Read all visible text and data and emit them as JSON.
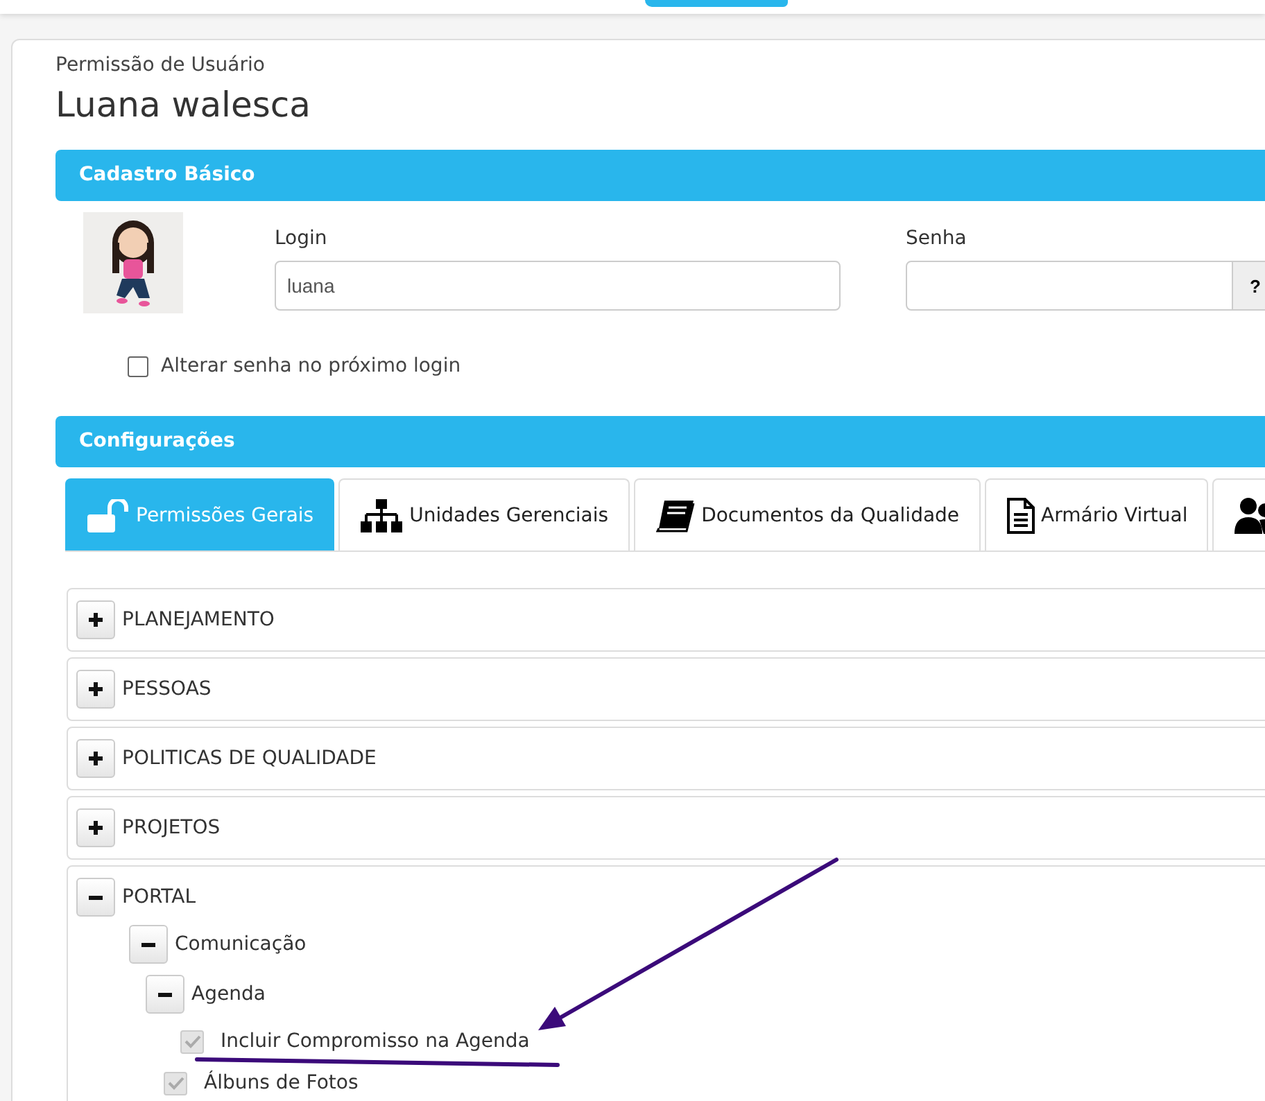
{
  "page": {
    "subtitle": "Permissão de Usuário",
    "title": "Luana walesca"
  },
  "basic": {
    "heading": "Cadastro Básico",
    "login": {
      "label": "Login",
      "value": "luana"
    },
    "password": {
      "label": "Senha",
      "help": "?"
    },
    "change_password": {
      "label": "Alterar senha no próximo login",
      "checked": false
    }
  },
  "config": {
    "heading": "Configurações",
    "tabs": [
      {
        "label": "Permissões Gerais",
        "selected": true
      },
      {
        "label": "Unidades Gerenciais",
        "selected": false
      },
      {
        "label": "Documentos da Qualidade",
        "selected": false
      },
      {
        "label": "Armário Virtual",
        "selected": false
      },
      {
        "selected": false
      }
    ],
    "sections": [
      {
        "kind": "group",
        "label": "PLANEJAMENTO",
        "expanded": false
      },
      {
        "kind": "group",
        "label": "PESSOAS",
        "expanded": false
      },
      {
        "kind": "group",
        "label": "POLITICAS DE QUALIDADE",
        "expanded": false
      },
      {
        "kind": "group",
        "label": "PROJETOS",
        "expanded": false
      },
      {
        "kind": "group",
        "label": "PORTAL",
        "expanded": true,
        "children": [
          {
            "kind": "group",
            "label": "Comunicação",
            "expanded": true,
            "children": [
              {
                "kind": "group",
                "label": "Agenda",
                "expanded": true,
                "children": [
                  {
                    "kind": "permission",
                    "label": "Incluir Compromisso na Agenda",
                    "checked": true,
                    "disabled": true
                  }
                ]
              },
              {
                "kind": "permission",
                "label": "Álbuns de Fotos",
                "checked": true,
                "disabled": true
              }
            ]
          }
        ]
      }
    ]
  }
}
